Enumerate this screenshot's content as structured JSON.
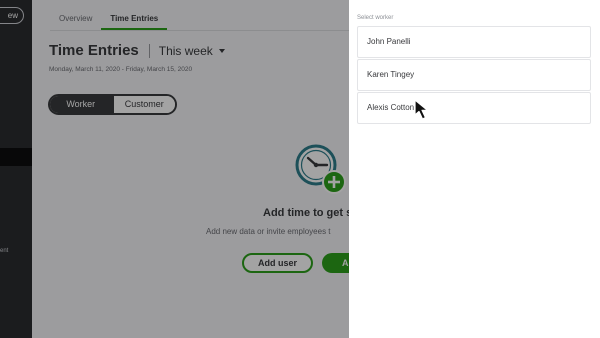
{
  "nav": {
    "new_button_label": "ew",
    "truncated_item_label": "ent"
  },
  "tabs": [
    {
      "label": "Overview",
      "active": false
    },
    {
      "label": "Time Entries",
      "active": true
    }
  ],
  "header": {
    "title": "Time Entries",
    "period": "This week",
    "date_range": "Monday, March 11, 2020 - Friday, March 15, 2020"
  },
  "view_toggle": {
    "worker_label": "Worker",
    "customer_label": "Customer",
    "selected": "Worker"
  },
  "empty_state": {
    "icon": "clock-add-icon",
    "title": "Add time to get s",
    "subtitle": "Add new data or invite employees t",
    "add_user_label": "Add user",
    "primary_label": "A"
  },
  "drawer": {
    "label": "Select worker",
    "workers": [
      "John Panelli",
      "Karen Tingey",
      "Alexis Cotton"
    ]
  },
  "colors": {
    "accent_green": "#2ca01c",
    "clock_teal": "#2e7d8c",
    "dark_text": "#393a3d",
    "nav_dark": "#2b2c30"
  }
}
